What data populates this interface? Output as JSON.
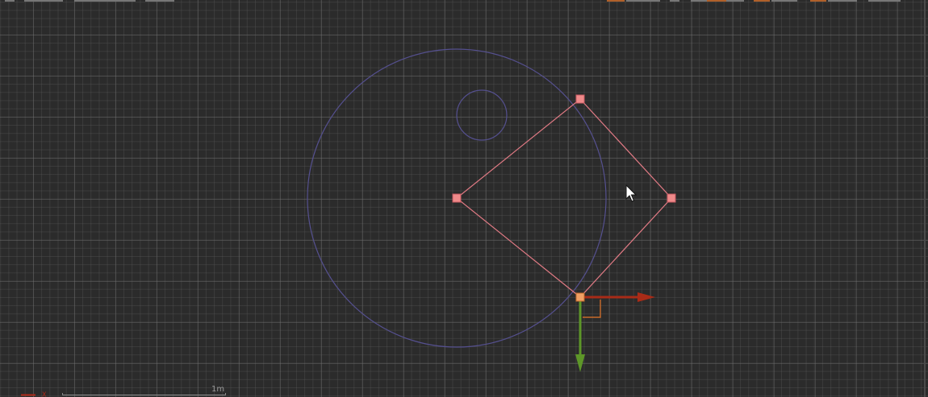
{
  "viewport": {
    "scale_label": "1m",
    "axis_indicator_label": "X"
  },
  "colors": {
    "background": "#2b2b2b",
    "circle_stroke": "#55508f",
    "shape_edge": "#e07a84",
    "vertex": "#ef8a8a",
    "selected_vertex": "#f0a064",
    "gizmo_x_axis": "#a82b17",
    "gizmo_y_axis": "#5d9628"
  },
  "icons": {
    "cursor": "mouse-pointer-icon",
    "transform_gizmo": "move-gizmo-icon"
  }
}
